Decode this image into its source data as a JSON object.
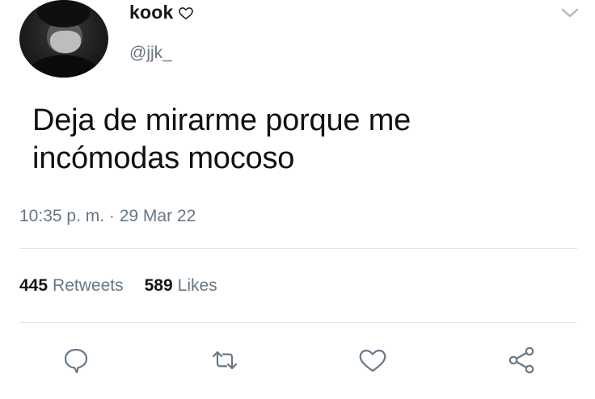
{
  "tweet": {
    "display_name": "kook",
    "handle": "@jjk_",
    "text_line1": "Deja de mirarme porque me",
    "text_line2": "incómodas mocoso",
    "timestamp": "10:35 p. m. · 29 Mar 22"
  },
  "stats": {
    "retweets_count": "445",
    "retweets_label": "Retweets",
    "likes_count": "589",
    "likes_label": "Likes"
  },
  "icons": {
    "name_badge": "heart-outline-icon",
    "menu": "chevron-down-icon",
    "reply": "comment-icon",
    "retweet": "retweet-icon",
    "like": "heart-icon",
    "share": "share-icon"
  },
  "colors": {
    "text_primary": "#14171a",
    "text_secondary": "#657786",
    "divider": "#dfe3e7"
  }
}
